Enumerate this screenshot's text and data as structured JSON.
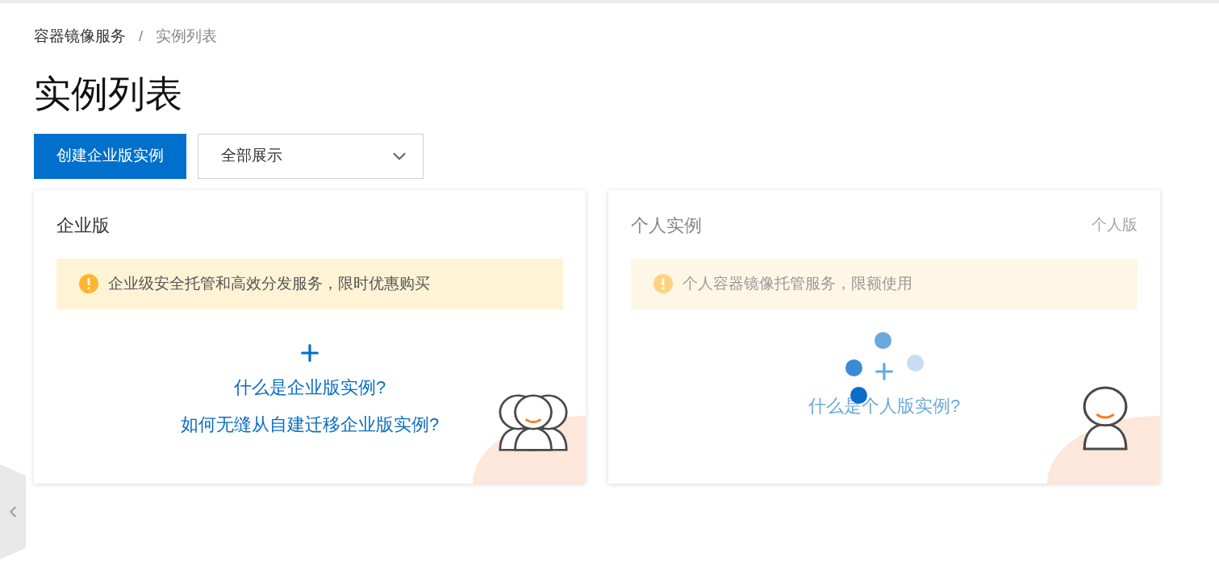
{
  "breadcrumb": {
    "items": [
      "容器镜像服务",
      "实例列表"
    ],
    "separator": "/"
  },
  "title": "实例列表",
  "toolbar": {
    "create_button": "创建企业版实例",
    "filter": {
      "value": "全部展示"
    }
  },
  "cards": [
    {
      "kind": "enterprise",
      "title": "企业版",
      "notice": "企业级安全托管和高效分发服务，限时优惠购买",
      "links": [
        "什么是企业版实例?",
        "如何无缝从自建迁移企业版实例?"
      ],
      "loading": false
    },
    {
      "kind": "personal",
      "title": "个人实例",
      "tag": "个人版",
      "notice": "个人容器镜像托管服务，限额使用",
      "links": [
        "什么是个人版实例?"
      ],
      "loading": true
    }
  ]
}
